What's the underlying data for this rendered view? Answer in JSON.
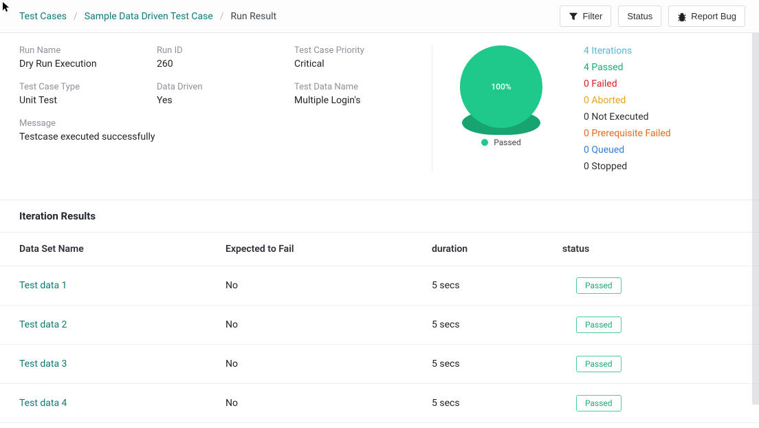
{
  "breadcrumb": {
    "items": [
      {
        "text": "Test Cases",
        "link": true
      },
      {
        "text": "Sample Data Driven Test Case",
        "link": true
      },
      {
        "text": "Run Result",
        "link": false
      }
    ]
  },
  "toolbar": {
    "filter": "Filter",
    "status": "Status",
    "report_bug": "Report Bug"
  },
  "summary": {
    "run_name": {
      "label": "Run Name",
      "value": "Dry Run Execution"
    },
    "run_id": {
      "label": "Run ID",
      "value": "260"
    },
    "priority": {
      "label": "Test Case Priority",
      "value": "Critical"
    },
    "case_type": {
      "label": "Test Case Type",
      "value": "Unit Test"
    },
    "data_driven": {
      "label": "Data Driven",
      "value": "Yes"
    },
    "data_name": {
      "label": "Test Data Name",
      "value": "Multiple Login's"
    },
    "message": {
      "label": "Message",
      "value": "Testcase executed successfully"
    }
  },
  "chart_data": {
    "type": "pie",
    "title": "",
    "slices": [
      {
        "name": "Passed",
        "value": 4,
        "percent": 100,
        "color": "#1ec98b"
      }
    ],
    "center_label": "100%",
    "legend": [
      "Passed"
    ]
  },
  "stats": {
    "iterations": {
      "count": 4,
      "label": "Iterations"
    },
    "passed": {
      "count": 4,
      "label": "Passed"
    },
    "failed": {
      "count": 0,
      "label": "Failed"
    },
    "aborted": {
      "count": 0,
      "label": "Aborted"
    },
    "not_executed": {
      "count": 0,
      "label": "Not Executed"
    },
    "prereq_fail": {
      "count": 0,
      "label": "Prerequisite Failed"
    },
    "queued": {
      "count": 0,
      "label": "Queued"
    },
    "stopped": {
      "count": 0,
      "label": "Stopped"
    }
  },
  "iteration_section_title": "Iteration Results",
  "iteration_headers": {
    "data_set": "Data Set Name",
    "exp_fail": "Expected to Fail",
    "duration": "duration",
    "status": "status"
  },
  "iteration_rows": [
    {
      "name": "Test data 1",
      "exp_fail": "No",
      "duration": "5 secs",
      "status": "Passed"
    },
    {
      "name": "Test data 2",
      "exp_fail": "No",
      "duration": "5 secs",
      "status": "Passed"
    },
    {
      "name": "Test data 3",
      "exp_fail": "No",
      "duration": "5 secs",
      "status": "Passed"
    },
    {
      "name": "Test data 4",
      "exp_fail": "No",
      "duration": "5 secs",
      "status": "Passed"
    }
  ]
}
